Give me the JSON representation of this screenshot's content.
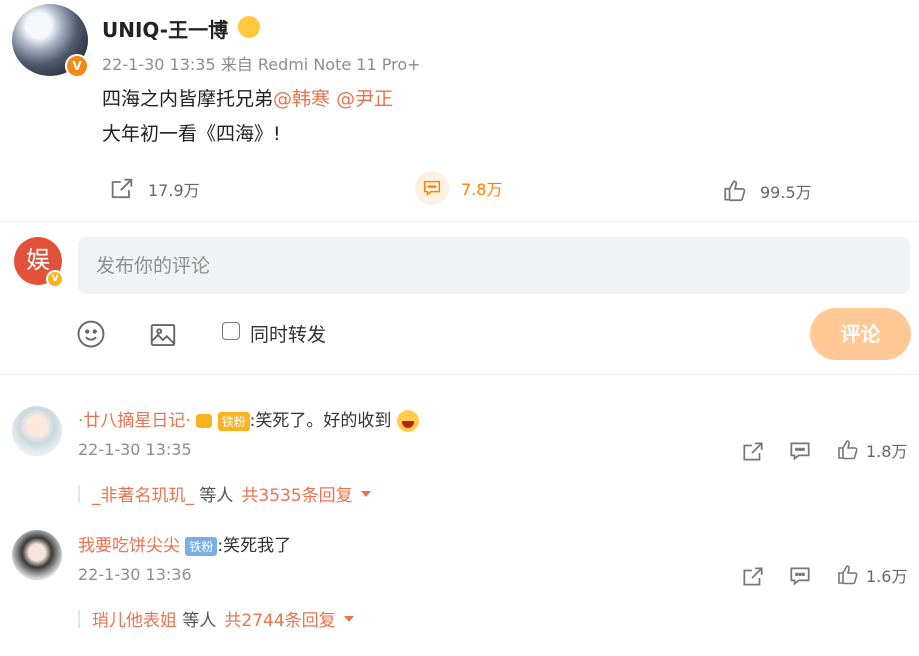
{
  "post": {
    "author": "UNIQ-王一博",
    "time": "22-1-30 13:35",
    "source": "来自 Redmi Note 11 Pro+",
    "line1_text": "四海之内皆摩托兄弟",
    "mention1": "@韩寒",
    "mention2": "@尹正",
    "line2": "大年初一看《四海》!",
    "reposts": "17.9万",
    "comments": "7.8万",
    "likes": "99.5万"
  },
  "composer": {
    "placeholder": "发布你的评论",
    "repost_label": "同时转发",
    "submit_label": "评论",
    "avatar_text": "娱"
  },
  "comments": [
    {
      "user": "·廿八摘星日记·",
      "badge": "铁粉",
      "text": ":笑死了。好的收到",
      "time": "22-1-30 13:35",
      "likes": "1.8万",
      "reply_user": "_非著名玑玑_",
      "reply_mid": "等人",
      "reply_count": "共3535条回复"
    },
    {
      "user": "我要吃饼尖尖",
      "badge": "铁粉",
      "text": ":笑死我了",
      "time": "22-1-30 13:36",
      "likes": "1.6万",
      "reply_user": "琑儿他表姐",
      "reply_mid": "等人",
      "reply_count": "共2744条回复"
    }
  ],
  "colors": {
    "accent": "#eb7350",
    "active": "#ff8200",
    "submit_disabled": "#ffc894",
    "fan_badge": "#7aaee6"
  }
}
